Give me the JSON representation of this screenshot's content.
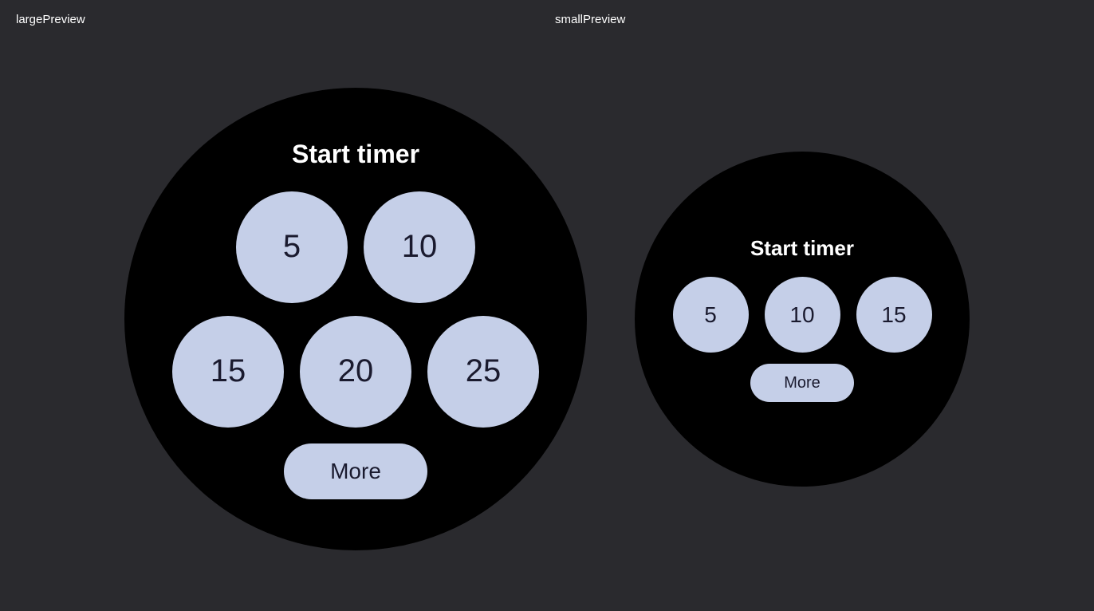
{
  "labels": {
    "large_preview": "largePreview",
    "small_preview": "smallPreview"
  },
  "large_watch": {
    "title": "Start timer",
    "buttons": [
      "5",
      "10",
      "15",
      "20",
      "25"
    ],
    "more_label": "More"
  },
  "small_watch": {
    "title": "Start timer",
    "buttons": [
      "5",
      "10",
      "15"
    ],
    "more_label": "More"
  },
  "colors": {
    "background": "#2a2a2e",
    "watch_bg": "#000000",
    "btn_bg": "#c5cfe8",
    "btn_text": "#1a1a2e",
    "label_text": "#ffffff"
  }
}
